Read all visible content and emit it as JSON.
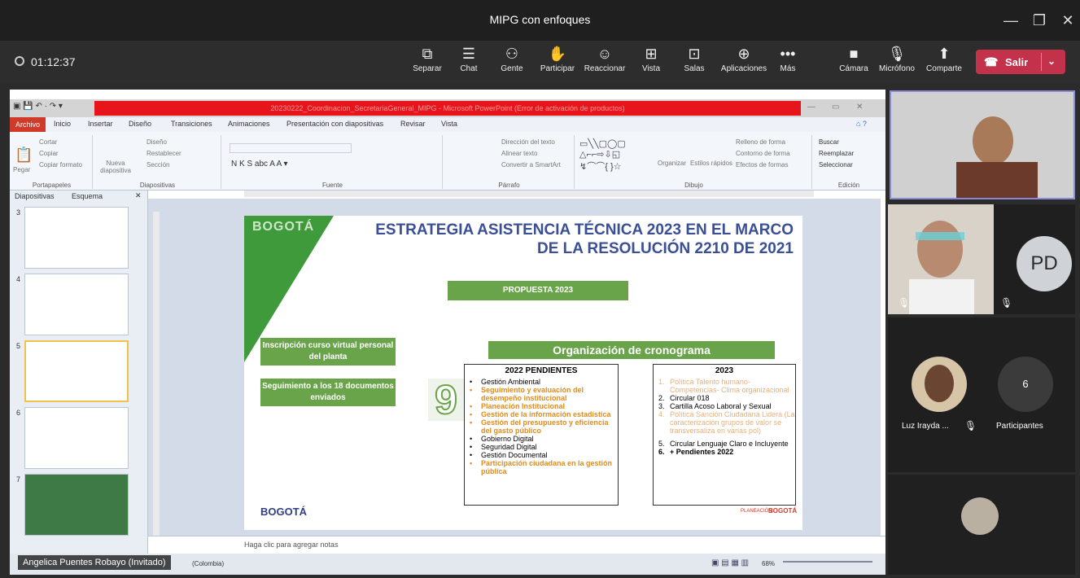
{
  "window": {
    "title": "MIPG con enfoques"
  },
  "callbar": {
    "timer": "01:12:37",
    "buttons": [
      {
        "icon": "undock-icon",
        "label": "Separar"
      },
      {
        "icon": "chat-icon",
        "label": "Chat"
      },
      {
        "icon": "people-icon",
        "label": "Gente"
      },
      {
        "icon": "raise-hand-icon",
        "label": "Participar"
      },
      {
        "icon": "emoji-icon",
        "label": "Reaccionar"
      },
      {
        "icon": "view-icon",
        "label": "Vista"
      },
      {
        "icon": "rooms-icon",
        "label": "Salas"
      },
      {
        "icon": "apps-icon",
        "label": "Aplicaciones"
      },
      {
        "icon": "more-icon",
        "label": "Más"
      },
      {
        "icon": "camera-off-icon",
        "label": "Cámara"
      },
      {
        "icon": "mic-off-icon",
        "label": "Micrófono"
      },
      {
        "icon": "share-icon",
        "label": "Comparte"
      }
    ],
    "leave_label": "Salir"
  },
  "powerpoint": {
    "title": "20230222_Coordinacion_SecretariaGeneral_MIPG - Microsoft PowerPoint (Error de activación de productos)",
    "tabs": [
      "Archivo",
      "Inicio",
      "Insertar",
      "Diseño",
      "Transiciones",
      "Animaciones",
      "Presentación con diapositivas",
      "Revisar",
      "Vista"
    ],
    "ribbon_groups": [
      "Portapapeles",
      "Diapositivas",
      "Fuente",
      "Párrafo",
      "Dibujo",
      "Edición"
    ],
    "ribbon_items": {
      "cortar": "Cortar",
      "copiar": "Copiar",
      "pegar": "Pegar",
      "copiar_formato": "Copiar formato",
      "nueva": "Nueva diapositiva",
      "diseno": "Diseño",
      "restablecer": "Restablecer",
      "seccion": "Sección",
      "direccion": "Dirección del texto",
      "alinear": "Alinear texto",
      "convertir": "Convertir a SmartArt",
      "organizar": "Organizar",
      "estilos": "Estilos rápidos",
      "relleno": "Relleno de forma",
      "contorno": "Contorno de forma",
      "efectos": "Efectos de formas",
      "buscar": "Buscar",
      "reemplazar": "Reemplazar",
      "seleccionar": "Seleccionar"
    },
    "panel_tabs": [
      "Diapositivas",
      "Esquema"
    ],
    "slide_numbers": [
      "3",
      "4",
      "5",
      "6",
      "7"
    ],
    "notes_placeholder": "Haga clic para agregar notas",
    "status": "(Colombia)",
    "zoom": "68%"
  },
  "slide": {
    "title_line1": "ESTRATEGIA ASISTENCIA TÉCNICA 2023 EN EL MARCO",
    "title_line2": "DE LA RESOLUCIÓN 2210 DE 2021",
    "propuesta": "PROPUESTA 2023",
    "box1": "Inscripción curso virtual personal del planta",
    "box2": "Seguimiento a los 18 documentos enviados",
    "organizacion": "Organización de cronograma",
    "big_number": "9",
    "pendientes_header": "2022 PENDIENTES",
    "pendientes": [
      {
        "text": "Gestión Ambiental",
        "style": "normal"
      },
      {
        "text": "Seguimiento y evaluación del desempeño institucional",
        "style": "orange"
      },
      {
        "text": "Planeación Institucional",
        "style": "orange"
      },
      {
        "text": "Gestión de la información estadística",
        "style": "orange"
      },
      {
        "text": "Gestión del presupuesto y eficiencia del gasto público",
        "style": "orange"
      },
      {
        "text": "Gobierno Digital",
        "style": "normal"
      },
      {
        "text": "Seguridad Digital",
        "style": "normal"
      },
      {
        "text": "Gestión Documental",
        "style": "normal"
      },
      {
        "text": "Participación ciudadana en la gestión pública",
        "style": "orange"
      }
    ],
    "year_header": "2023",
    "items_2023": [
      {
        "num": "1.",
        "text": "Política Talento humano- Competencias- Clima organizacional",
        "style": "pale"
      },
      {
        "num": "2.",
        "text": "Circular 018",
        "style": "normal"
      },
      {
        "num": "3.",
        "text": "Cartilla Acoso Laboral y Sexual",
        "style": "normal"
      },
      {
        "num": "4.",
        "text": "Política Sanción Ciudadana Lidera (La caracterización grupos de valor se transversaliza en varias pol)",
        "style": "pale"
      },
      {
        "num": "5.",
        "text": "Circular Lenguaje Claro e Incluyente",
        "style": "normal"
      },
      {
        "num": "6.",
        "text": "+ Pendientes 2022",
        "style": "bold"
      }
    ],
    "logo_text": "BOGOTÁ",
    "footer_logo": "BOGOTÁ",
    "footer_plan": "PLANEACIÓN"
  },
  "presenter": {
    "name": "Angelica Puentes Robayo (Invitado)"
  },
  "participants": {
    "pd_initials": "PD",
    "luz_name": "Luz Irayda ...",
    "count": "6",
    "count_label": "Participantes"
  }
}
